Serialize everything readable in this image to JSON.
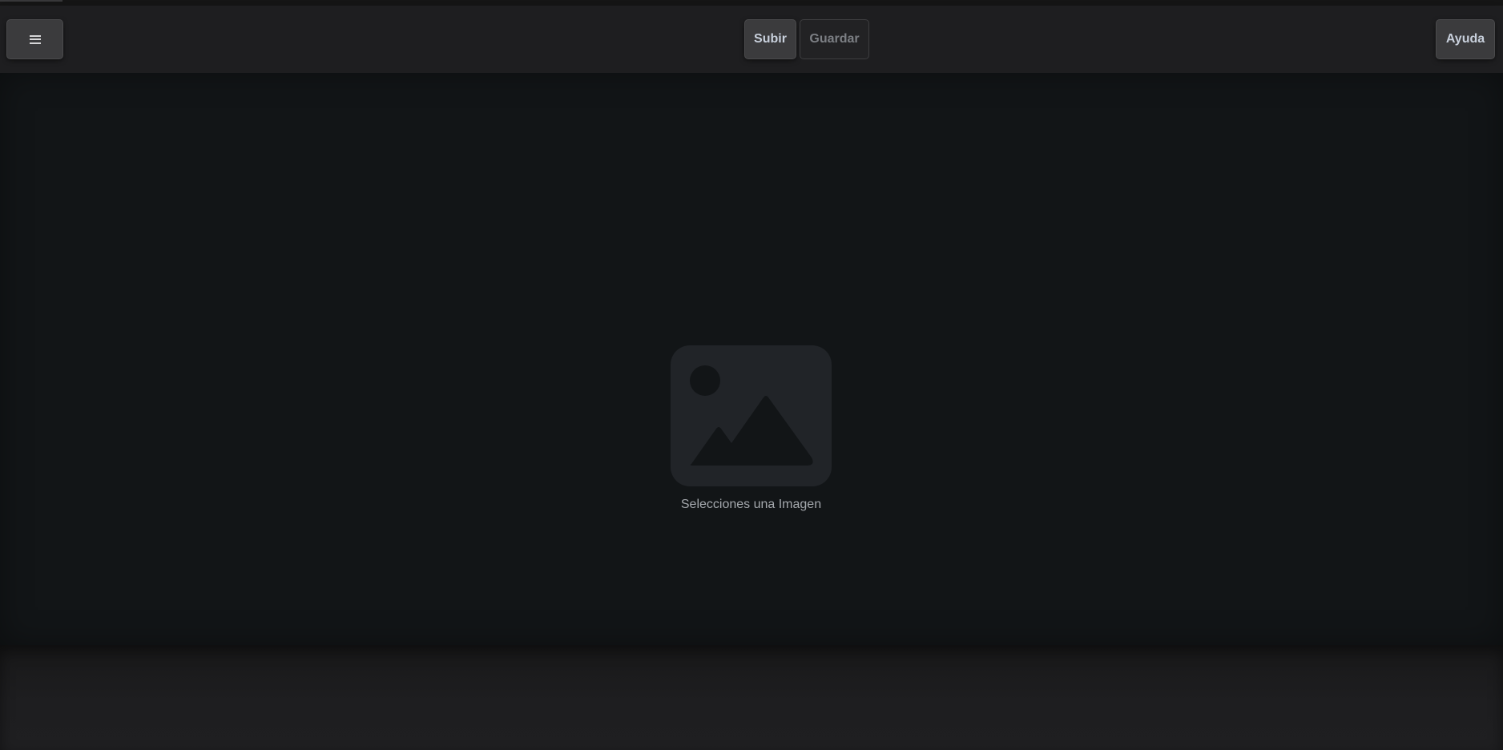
{
  "toolbar": {
    "menu_icon": "hamburger-menu-icon",
    "upload_label": "Subir",
    "save_label": "Guardar",
    "help_label": "Ayuda"
  },
  "canvas": {
    "placeholder_icon": "image-placeholder-icon",
    "placeholder_text": "Selecciones una Imagen"
  },
  "colors": {
    "background": "#151718",
    "toolbar": "#1e1e20",
    "canvas": "#121517",
    "button": "#3b3b3d",
    "disabled_button": "#222224",
    "placeholder_icon": "#212428",
    "placeholder_text": "#a4a8ad"
  }
}
